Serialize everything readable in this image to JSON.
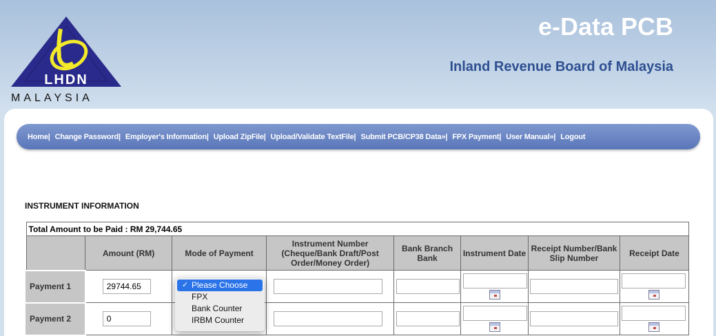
{
  "header": {
    "logo_text": "LHDN",
    "logo_country": "MALAYSIA",
    "app_title": "e-Data PCB",
    "org_title": "Inland Revenue Board of Malaysia"
  },
  "nav": {
    "items": [
      "Home|",
      "Change Password|",
      "Employer's Information|",
      "Upload ZipFile|",
      "Upload/Validate TextFile|",
      "Submit PCB/CP38 Data»|",
      "FPX Payment|",
      "User Manual»|",
      "Logout"
    ]
  },
  "section": {
    "title": "INSTRUMENT INFORMATION"
  },
  "table": {
    "total_label": "Total Amount to be Paid : RM 29,744.65",
    "headers": [
      "",
      "Amount (RM)",
      "Mode of Payment",
      "Instrument Number (Cheque/Bank Draft/Post Order/Money Order)",
      "Bank Branch Bank",
      "Instrument Date",
      "Receipt Number/Bank Slip Number",
      "Receipt Date"
    ],
    "rows": [
      {
        "label": "Payment 1",
        "amount": "29744.65"
      },
      {
        "label": "Payment 2",
        "amount": "0"
      }
    ]
  },
  "dropdown": {
    "options": [
      "Please Choose",
      "FPX",
      "Bank Counter",
      "IRBM Counter"
    ],
    "selected": "Please Choose"
  },
  "colors": {
    "nav_bg": "#6f88c6",
    "header_bg": "#b7cce3",
    "org_title": "#2e4f91",
    "table_header_bg": "#c6c6c6",
    "dropdown_selected": "#2a73e8"
  }
}
